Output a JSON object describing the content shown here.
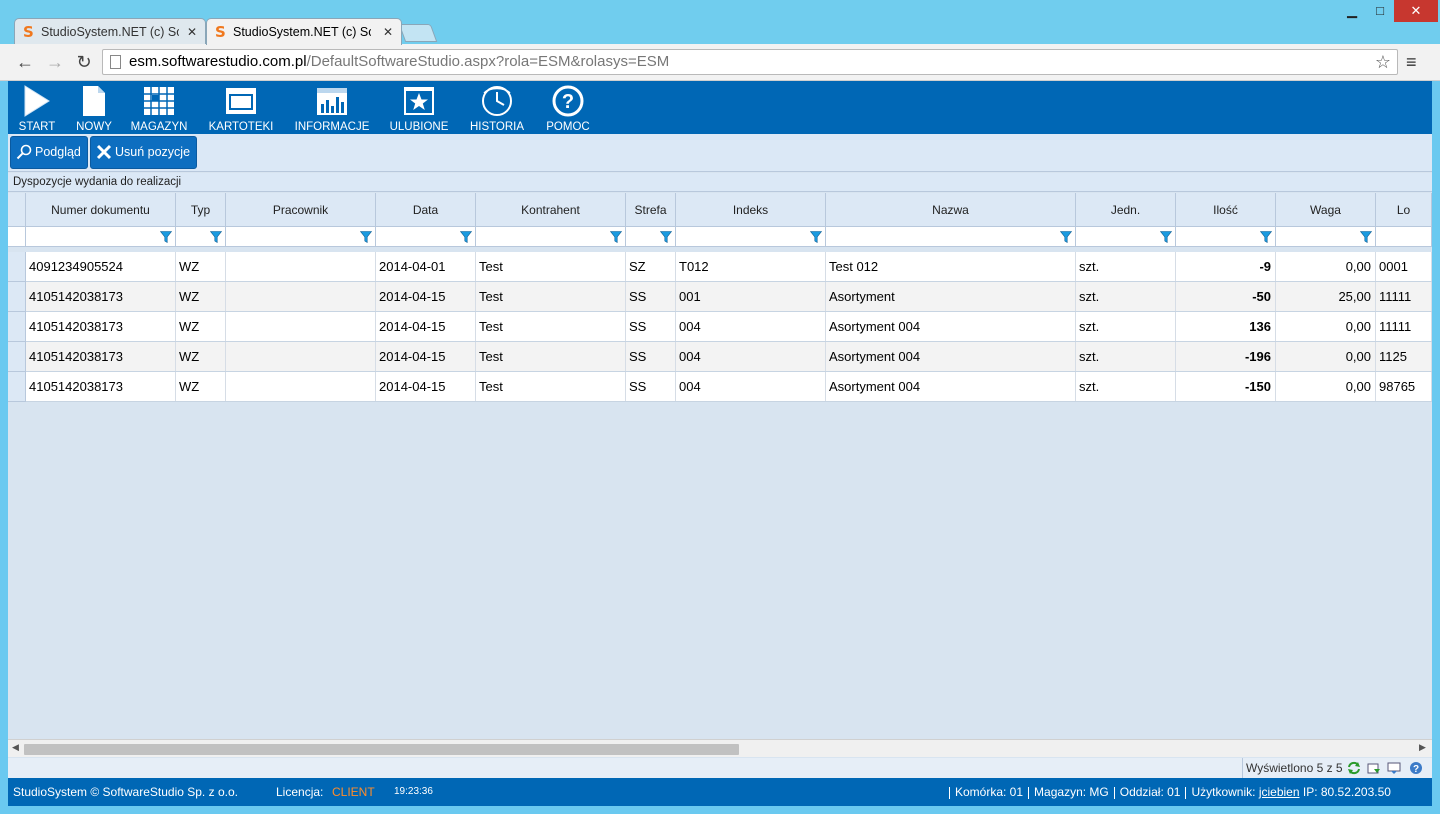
{
  "browser": {
    "tabs": [
      {
        "title": "StudioSystem.NET (c) Soft",
        "active": false
      },
      {
        "title": "StudioSystem.NET (c) Soft",
        "active": true
      }
    ],
    "url_host": "esm.softwarestudio.com.pl",
    "url_path": "/DefaultSoftwareStudio.aspx?rola=ESM&rolasys=ESM",
    "window_controls": {
      "minimize": "▁",
      "maximize": "□",
      "close": "✕"
    }
  },
  "main_menu": [
    {
      "id": "start",
      "label": "START",
      "icon": "play-icon"
    },
    {
      "id": "nowy",
      "label": "NOWY",
      "icon": "new-document-icon"
    },
    {
      "id": "magazyn",
      "label": "MAGAZYN",
      "icon": "warehouse-grid-icon"
    },
    {
      "id": "kartoteki",
      "label": "KARTOTEKI",
      "icon": "window-icon"
    },
    {
      "id": "informacje",
      "label": "INFORMACJE",
      "icon": "bar-chart-icon"
    },
    {
      "id": "ulubione",
      "label": "ULUBIONE",
      "icon": "star-icon"
    },
    {
      "id": "historia",
      "label": "HISTORIA",
      "icon": "history-clock-icon"
    },
    {
      "id": "pomoc",
      "label": "POMOC",
      "icon": "help-icon"
    }
  ],
  "toolbar": {
    "preview_label": "Podgląd",
    "remove_label": "Usuń pozycje"
  },
  "grid": {
    "caption": "Dyspozycje wydania do realizacji",
    "columns": [
      "Numer dokumentu",
      "Typ",
      "Pracownik",
      "Data",
      "Kontrahent",
      "Strefa",
      "Indeks",
      "Nazwa",
      "Jedn.",
      "Ilość",
      "Waga",
      "Lo"
    ],
    "rows": [
      [
        "4091234905524",
        "WZ",
        "",
        "2014-04-01",
        "Test",
        "SZ",
        "T012",
        "Test 012",
        "szt.",
        "-9",
        "0,00",
        "0001"
      ],
      [
        "4105142038173",
        "WZ",
        "",
        "2014-04-15",
        "Test",
        "SS",
        "001",
        "Asortyment",
        "szt.",
        "-50",
        "25,00",
        "11111"
      ],
      [
        "4105142038173",
        "WZ",
        "",
        "2014-04-15",
        "Test",
        "SS",
        "004",
        "Asortyment 004",
        "szt.",
        "136",
        "0,00",
        "11111"
      ],
      [
        "4105142038173",
        "WZ",
        "",
        "2014-04-15",
        "Test",
        "SS",
        "004",
        "Asortyment 004",
        "szt.",
        "-196",
        "0,00",
        "1125"
      ],
      [
        "4105142038173",
        "WZ",
        "",
        "2014-04-15",
        "Test",
        "SS",
        "004",
        "Asortyment 004",
        "szt.",
        "-150",
        "0,00",
        "98765"
      ]
    ]
  },
  "pager": {
    "text": "Wyświetlono 5 z 5"
  },
  "status": {
    "copyright": "StudioSystem © SoftwareStudio Sp. z o.o.",
    "license_label": "Licencja:",
    "license_value": "CLIENT",
    "clock": "19:23:36",
    "komorka": "Komórka: 01",
    "magazyn": "Magazyn: MG",
    "oddzial": "Oddział: 01",
    "user_label": "Użytkownik:",
    "user_value": "jciebien",
    "ip": "IP: 80.52.203.50"
  },
  "colors": {
    "menu_bg": "#0067b5",
    "toolbar_bg": "#dbe8f6",
    "license_accent": "#ff8c2a",
    "browser_frame": "#6ac9f0"
  }
}
